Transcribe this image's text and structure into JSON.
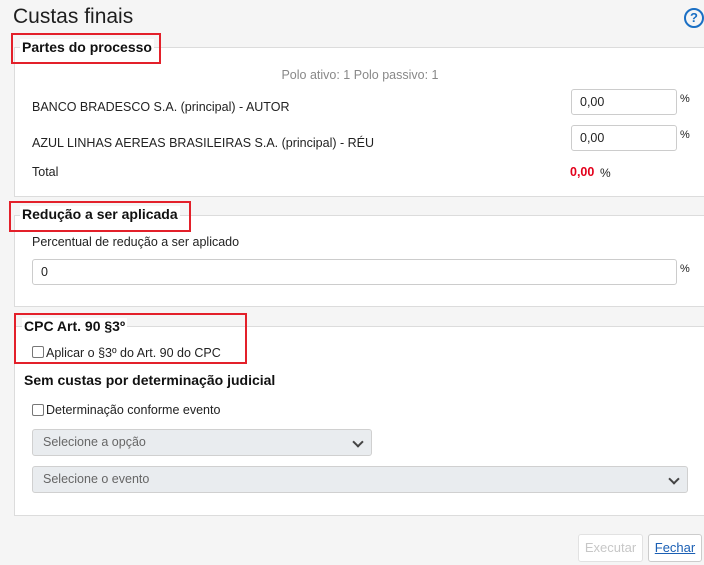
{
  "page": {
    "title": "Custas finais"
  },
  "header": {
    "help_icon_glyph": "?"
  },
  "partes": {
    "legend": "Partes do processo",
    "summary": "Polo ativo: 1 Polo passivo: 1",
    "rows": [
      {
        "name": "BANCO BRADESCO S.A. (principal) - AUTOR",
        "value": "0,00",
        "unit": "%"
      },
      {
        "name": "AZUL LINHAS AEREAS BRASILEIRAS S.A. (principal) - RÉU",
        "value": "0,00",
        "unit": "%"
      }
    ],
    "total_label": "Total",
    "total_value": "0,00",
    "total_unit": "%",
    "total_color": "#e3001b"
  },
  "reducao": {
    "legend": "Redução a ser aplicada",
    "label": "Percentual de redução a ser aplicado",
    "value": "0",
    "unit": "%"
  },
  "cpc": {
    "legend": "CPC Art. 90 §3º",
    "checkbox_label": "Aplicar o §3º do Art. 90 do CPC",
    "checked": false
  },
  "sem_custas": {
    "heading": "Sem custas por determinação judicial",
    "checkbox_label": "Determinação conforme evento",
    "checked": false,
    "select_option": "Selecione a opção",
    "select_event": "Selecione o evento"
  },
  "footer": {
    "execute_label": "Executar",
    "close_label": "Fechar"
  },
  "colors": {
    "highlight": "#e3202a",
    "accent": "#1a6fc4"
  }
}
